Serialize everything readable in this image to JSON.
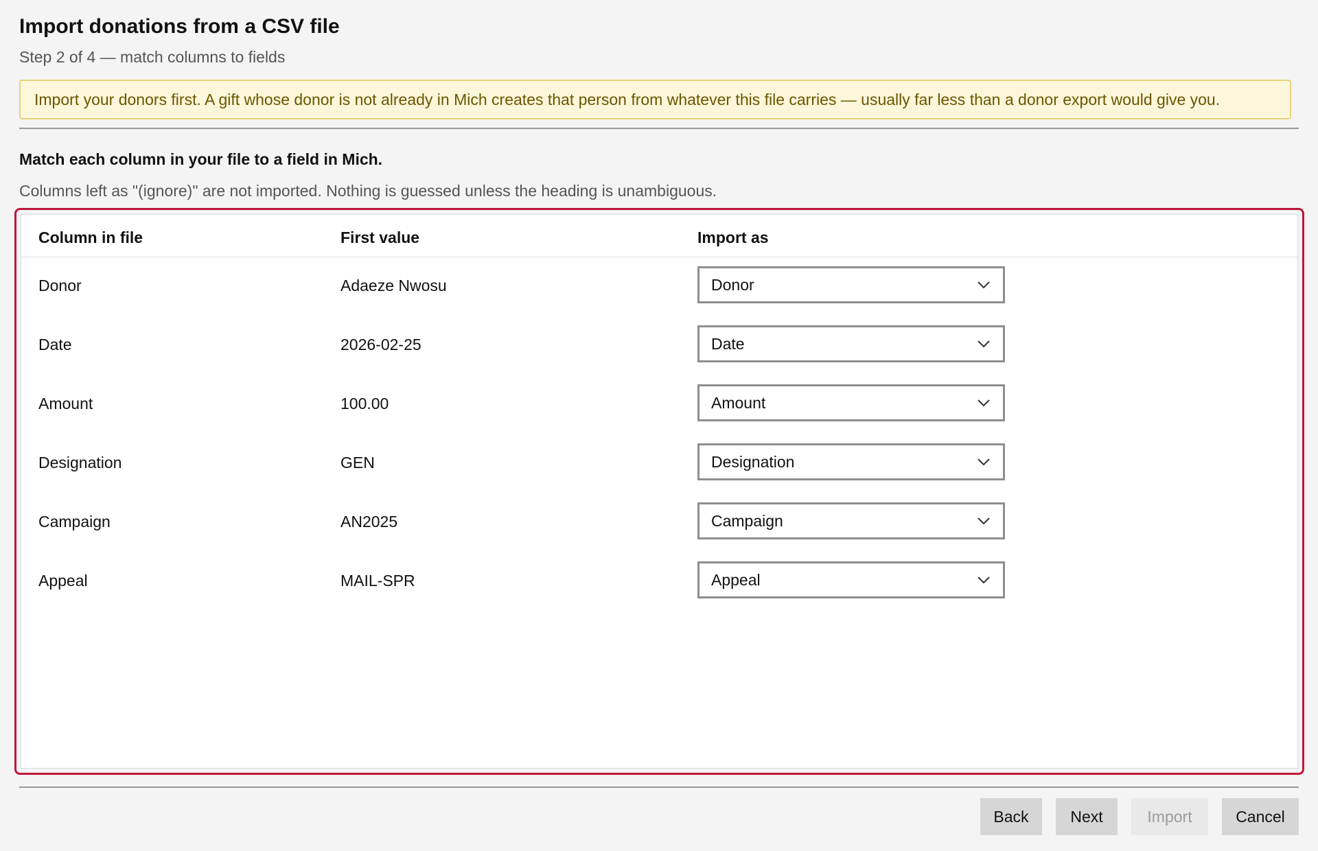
{
  "header": {
    "title": "Import donations from a CSV file",
    "step": "Step 2 of 4 — match columns to fields"
  },
  "banner": {
    "text": "Import your donors first. A gift whose donor is not already in Mich creates that person from whatever this file carries — usually far less than a donor export would give you.",
    "bg_color": "#fcf7da",
    "border_color": "#e6d47a",
    "text_color": "#6b5500"
  },
  "section": {
    "heading": "Match each column in your file to a field in Mich.",
    "hint": "Columns left as \"(ignore)\" are not imported. Nothing is guessed unless the heading is unambiguous."
  },
  "grid": {
    "focus_color": "#c0163a",
    "columns": [
      "Column in file",
      "First value",
      "Import as"
    ],
    "rows": [
      {
        "column": "Donor",
        "first_value": "Adaeze Nwosu",
        "import_as": "Donor"
      },
      {
        "column": "Date",
        "first_value": "2026-02-25",
        "import_as": "Date"
      },
      {
        "column": "Amount",
        "first_value": "100.00",
        "import_as": "Amount"
      },
      {
        "column": "Designation",
        "first_value": "GEN",
        "import_as": "Designation"
      },
      {
        "column": "Campaign",
        "first_value": "AN2025",
        "import_as": "Campaign"
      },
      {
        "column": "Appeal",
        "first_value": "MAIL-SPR",
        "import_as": "Appeal"
      }
    ],
    "select_icon": "chevron-down-icon"
  },
  "buttons": {
    "back": "Back",
    "next": "Next",
    "import": "Import",
    "cancel": "Cancel"
  }
}
